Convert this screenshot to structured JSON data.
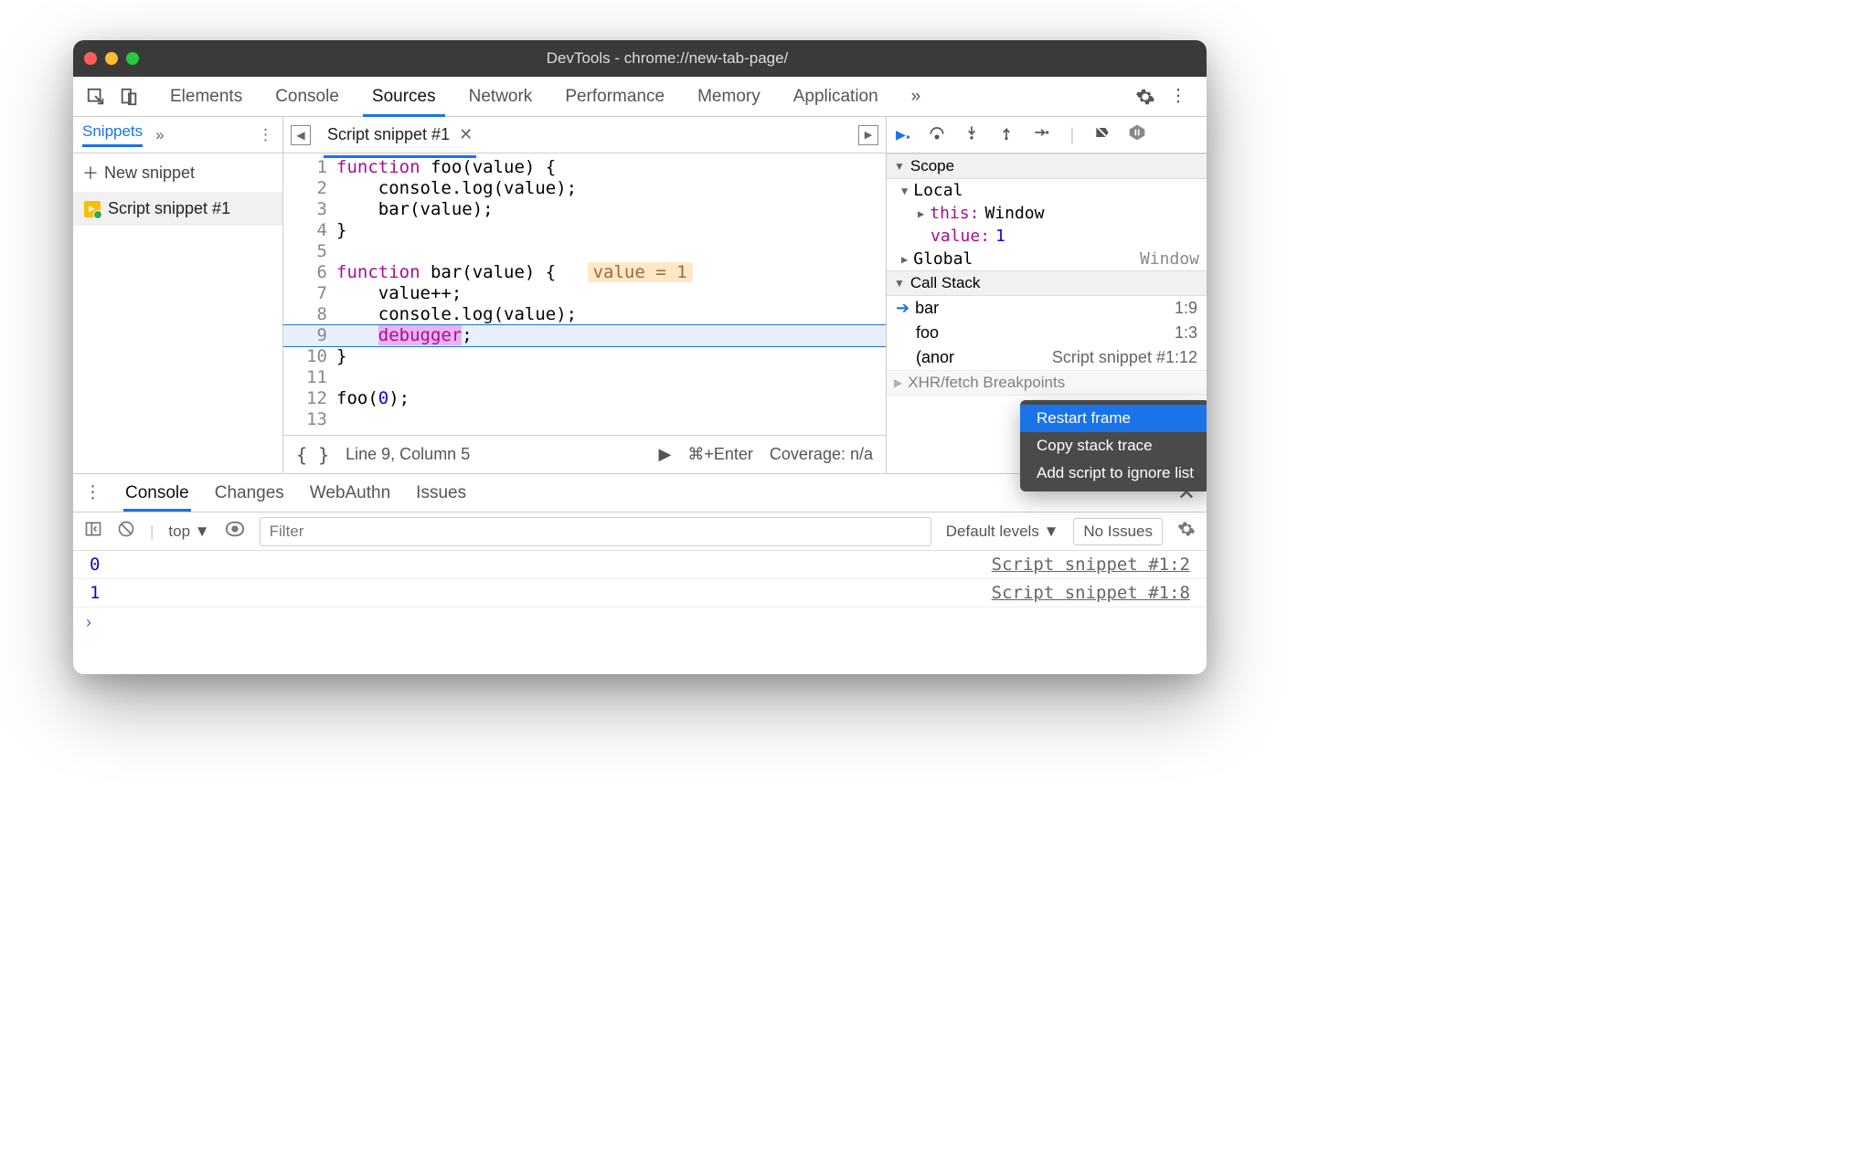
{
  "window_title": "DevTools - chrome://new-tab-page/",
  "main_tabs": [
    "Elements",
    "Console",
    "Sources",
    "Network",
    "Performance",
    "Memory",
    "Application"
  ],
  "active_main_tab": "Sources",
  "sidebar": {
    "tab": "Snippets",
    "new_label": "New snippet",
    "items": [
      "Script snippet #1"
    ]
  },
  "editor": {
    "tab": "Script snippet #1",
    "lines": [
      {
        "n": 1,
        "html": "<span class='kw'>function</span> <span class='fn'>foo</span>(value) {"
      },
      {
        "n": 2,
        "html": "    console.log(value);"
      },
      {
        "n": 3,
        "html": "    bar(value);"
      },
      {
        "n": 4,
        "html": "}"
      },
      {
        "n": 5,
        "html": " "
      },
      {
        "n": 6,
        "html": "<span class='kw'>function</span> <span class='fn'>bar</span>(value) {   <span class='hl-value'>value = 1</span>"
      },
      {
        "n": 7,
        "html": "    value++;"
      },
      {
        "n": 8,
        "html": "    console.log(value);"
      },
      {
        "n": 9,
        "html": "    <span class='dbg kw'>debugger</span>;",
        "hl": true
      },
      {
        "n": 10,
        "html": "}"
      },
      {
        "n": 11,
        "html": " "
      },
      {
        "n": 12,
        "html": "foo(<span class='num'>0</span>);"
      },
      {
        "n": 13,
        "html": " "
      }
    ],
    "status_cursor": "Line 9, Column 5",
    "status_run": "⌘+Enter",
    "status_coverage": "Coverage: n/a"
  },
  "debugger": {
    "scope": {
      "title": "Scope",
      "local_label": "Local",
      "this_label": "this",
      "this_value": "Window",
      "value_label": "value",
      "value_value": "1",
      "global_label": "Global",
      "global_value": "Window"
    },
    "callstack": {
      "title": "Call Stack",
      "frames": [
        {
          "name": "bar",
          "loc": "1:9",
          "current": true
        },
        {
          "name": "foo",
          "loc": "1:3"
        },
        {
          "name": "(anor",
          "loc": "Script snippet #1:12"
        }
      ]
    },
    "xhr_label": "XHR/fetch Breakpoints"
  },
  "context_menu": [
    "Restart frame",
    "Copy stack trace",
    "Add script to ignore list"
  ],
  "drawer": {
    "tabs": [
      "Console",
      "Changes",
      "WebAuthn",
      "Issues"
    ],
    "active": "Console",
    "top_label": "top",
    "filter_placeholder": "Filter",
    "levels": "Default levels",
    "issues": "No Issues",
    "output": [
      {
        "val": "0",
        "src": "Script snippet #1:2"
      },
      {
        "val": "1",
        "src": "Script snippet #1:8"
      }
    ]
  }
}
